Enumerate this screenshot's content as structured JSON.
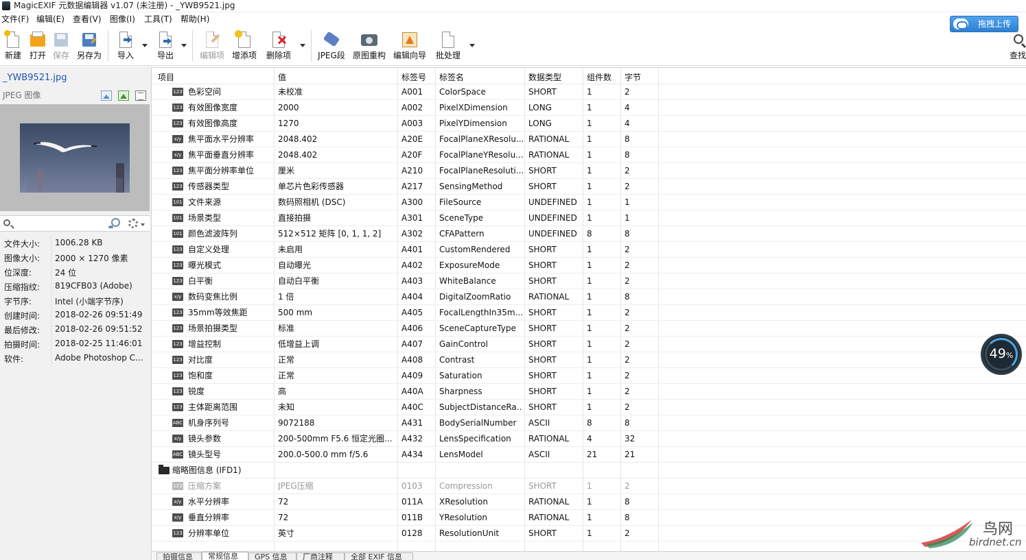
{
  "window": {
    "title": "MagicEXIF 元数据编辑器 v1.07 (未注册) - _YWB9521.jpg"
  },
  "menubar": [
    {
      "label": "文件(F)"
    },
    {
      "label": "编辑(E)"
    },
    {
      "label": "查看(V)"
    },
    {
      "label": "图像(I)"
    },
    {
      "label": "工具(T)"
    },
    {
      "label": "帮助(H)"
    }
  ],
  "toolbar": {
    "buttons": [
      {
        "label": "新建",
        "icon": "new-file-icon",
        "enabled": true
      },
      {
        "label": "打开",
        "icon": "open-folder-icon",
        "enabled": true
      },
      {
        "label": "保存",
        "icon": "save-disk-icon",
        "enabled": false
      },
      {
        "label": "另存为",
        "icon": "save-as-icon",
        "enabled": true
      },
      {
        "label": "导入",
        "icon": "import-icon",
        "enabled": true
      },
      {
        "label": "导出",
        "icon": "export-icon",
        "enabled": true
      },
      {
        "label": "编辑项",
        "icon": "edit-item-icon",
        "enabled": false
      },
      {
        "label": "增添项",
        "icon": "add-item-icon",
        "enabled": true
      },
      {
        "label": "删除项",
        "icon": "delete-item-icon",
        "enabled": true
      },
      {
        "label": "JPEG段",
        "icon": "jpeg-segment-tag-icon",
        "enabled": true
      },
      {
        "label": "原图重构",
        "icon": "camera-rebuild-icon",
        "enabled": true
      },
      {
        "label": "编辑向导",
        "icon": "wizard-icon",
        "enabled": true
      },
      {
        "label": "批处理",
        "icon": "batch-icon",
        "enabled": true
      },
      {
        "label": "查找",
        "icon": "search-icon",
        "enabled": true
      }
    ],
    "upload_label": "拖拽上传"
  },
  "file_panel": {
    "filename": "_YWB9521.jpg",
    "filetype": "JPEG 图像",
    "search_placeholder": "",
    "info": [
      {
        "key": "文件大小:",
        "value": "1006.28 KB"
      },
      {
        "key": "图像大小:",
        "value": "2000 × 1270 像素"
      },
      {
        "key": "位深度:",
        "value": "24 位"
      },
      {
        "key": "压缩指纹:",
        "value": "819CFB03 (Adobe)"
      },
      {
        "key": "字节序:",
        "value": "Intel (小端字节序)"
      },
      {
        "key": "创建时间:",
        "value": "2018-02-26 09:51:49"
      },
      {
        "key": "最后修改:",
        "value": "2018-02-26 09:51:52"
      },
      {
        "key": "拍摄时间:",
        "value": "2018-02-25 11:46:01"
      },
      {
        "key": "软件:",
        "value": "Adobe Photoshop C..."
      }
    ]
  },
  "table": {
    "columns": [
      "项目",
      "值",
      "标签号",
      "标签名",
      "数据类型",
      "组件数",
      "字节"
    ],
    "rows": [
      {
        "icon": "123",
        "name": "色彩空间",
        "value": "未校准",
        "tag": "A001",
        "tagname": "ColorSpace",
        "type": "SHORT",
        "count": "1",
        "bytes": "2"
      },
      {
        "icon": "123",
        "name": "有效图像宽度",
        "value": "2000",
        "tag": "A002",
        "tagname": "PixelXDimension",
        "type": "LONG",
        "count": "1",
        "bytes": "4"
      },
      {
        "icon": "123",
        "name": "有效图像高度",
        "value": "1270",
        "tag": "A003",
        "tagname": "PixelYDimension",
        "type": "LONG",
        "count": "1",
        "bytes": "4"
      },
      {
        "icon": "x/y",
        "name": "焦平面水平分辨率",
        "value": "2048.402",
        "tag": "A20E",
        "tagname": "FocalPlaneXResolu...",
        "type": "RATIONAL",
        "count": "1",
        "bytes": "8"
      },
      {
        "icon": "x/y",
        "name": "焦平面垂直分辨率",
        "value": "2048.402",
        "tag": "A20F",
        "tagname": "FocalPlaneYResolu...",
        "type": "RATIONAL",
        "count": "1",
        "bytes": "8"
      },
      {
        "icon": "123",
        "name": "焦平面分辨率单位",
        "value": "厘米",
        "tag": "A210",
        "tagname": "FocalPlaneResoluti...",
        "type": "SHORT",
        "count": "1",
        "bytes": "2"
      },
      {
        "icon": "123",
        "name": "传感器类型",
        "value": "单芯片色彩传感器",
        "tag": "A217",
        "tagname": "SensingMethod",
        "type": "SHORT",
        "count": "1",
        "bytes": "2"
      },
      {
        "icon": "101",
        "name": "文件来源",
        "value": "数码照相机 (DSC)",
        "tag": "A300",
        "tagname": "FileSource",
        "type": "UNDEFINED",
        "count": "1",
        "bytes": "1"
      },
      {
        "icon": "101",
        "name": "场景类型",
        "value": "直接拍摄",
        "tag": "A301",
        "tagname": "SceneType",
        "type": "UNDEFINED",
        "count": "1",
        "bytes": "1"
      },
      {
        "icon": "101",
        "name": "颜色滤波阵列",
        "value": "512×512 矩阵 [0, 1, 1, 2]",
        "tag": "A302",
        "tagname": "CFAPattern",
        "type": "UNDEFINED",
        "count": "8",
        "bytes": "8"
      },
      {
        "icon": "123",
        "name": "自定义处理",
        "value": "未启用",
        "tag": "A401",
        "tagname": "CustomRendered",
        "type": "SHORT",
        "count": "1",
        "bytes": "2"
      },
      {
        "icon": "123",
        "name": "曝光模式",
        "value": "自动曝光",
        "tag": "A402",
        "tagname": "ExposureMode",
        "type": "SHORT",
        "count": "1",
        "bytes": "2"
      },
      {
        "icon": "123",
        "name": "白平衡",
        "value": "自动白平衡",
        "tag": "A403",
        "tagname": "WhiteBalance",
        "type": "SHORT",
        "count": "1",
        "bytes": "2"
      },
      {
        "icon": "x/y",
        "name": "数码变焦比例",
        "value": "1 倍",
        "tag": "A404",
        "tagname": "DigitalZoomRatio",
        "type": "RATIONAL",
        "count": "1",
        "bytes": "8"
      },
      {
        "icon": "123",
        "name": "35mm等效焦距",
        "value": "500 mm",
        "tag": "A405",
        "tagname": "FocalLengthIn35m...",
        "type": "SHORT",
        "count": "1",
        "bytes": "2"
      },
      {
        "icon": "123",
        "name": "场景拍摄类型",
        "value": "标准",
        "tag": "A406",
        "tagname": "SceneCaptureType",
        "type": "SHORT",
        "count": "1",
        "bytes": "2"
      },
      {
        "icon": "123",
        "name": "增益控制",
        "value": "低增益上调",
        "tag": "A407",
        "tagname": "GainControl",
        "type": "SHORT",
        "count": "1",
        "bytes": "2"
      },
      {
        "icon": "123",
        "name": "对比度",
        "value": "正常",
        "tag": "A408",
        "tagname": "Contrast",
        "type": "SHORT",
        "count": "1",
        "bytes": "2"
      },
      {
        "icon": "123",
        "name": "饱和度",
        "value": "正常",
        "tag": "A409",
        "tagname": "Saturation",
        "type": "SHORT",
        "count": "1",
        "bytes": "2"
      },
      {
        "icon": "123",
        "name": "锐度",
        "value": "高",
        "tag": "A40A",
        "tagname": "Sharpness",
        "type": "SHORT",
        "count": "1",
        "bytes": "2"
      },
      {
        "icon": "123",
        "name": "主体距离范围",
        "value": "未知",
        "tag": "A40C",
        "tagname": "SubjectDistanceRa...",
        "type": "SHORT",
        "count": "1",
        "bytes": "2"
      },
      {
        "icon": "ABC",
        "name": "机身序列号",
        "value": "9072188",
        "tag": "A431",
        "tagname": "BodySerialNumber",
        "type": "ASCII",
        "count": "8",
        "bytes": "8"
      },
      {
        "icon": "x/y",
        "name": "镜头参数",
        "value": "200-500mm F5.6 恒定光圈...",
        "tag": "A432",
        "tagname": "LensSpecification",
        "type": "RATIONAL",
        "count": "4",
        "bytes": "32"
      },
      {
        "icon": "ABC",
        "name": "镜头型号",
        "value": "200.0-500.0 mm f/5.6",
        "tag": "A434",
        "tagname": "LensModel",
        "type": "ASCII",
        "count": "21",
        "bytes": "21"
      },
      {
        "group": true,
        "name": "缩略图信息 (IFD1)"
      },
      {
        "icon": "123",
        "grey": true,
        "name": "压缩方案",
        "value": "JPEG压缩",
        "tag": "0103",
        "tagname": "Compression",
        "type": "SHORT",
        "count": "1",
        "bytes": "2"
      },
      {
        "icon": "x/y",
        "name": "水平分辨率",
        "value": "72",
        "tag": "011A",
        "tagname": "XResolution",
        "type": "RATIONAL",
        "count": "1",
        "bytes": "8"
      },
      {
        "icon": "x/y",
        "name": "垂直分辨率",
        "value": "72",
        "tag": "011B",
        "tagname": "YResolution",
        "type": "RATIONAL",
        "count": "1",
        "bytes": "8"
      },
      {
        "icon": "123",
        "name": "分辨率单位",
        "value": "英寸",
        "tag": "0128",
        "tagname": "ResolutionUnit",
        "type": "SHORT",
        "count": "1",
        "bytes": "2"
      }
    ]
  },
  "tabs": [
    {
      "label": "拍摄信息"
    },
    {
      "label": "常规信息",
      "active": true
    },
    {
      "label": "GPS 信息"
    },
    {
      "label": "厂商注释"
    },
    {
      "label": "全部 EXIF 信息"
    }
  ],
  "overlay": {
    "progress_percent": 49,
    "progress_text": "49",
    "progress_unit": "%"
  },
  "watermark": {
    "name": "鸟网",
    "url": "birdnet.cn"
  }
}
